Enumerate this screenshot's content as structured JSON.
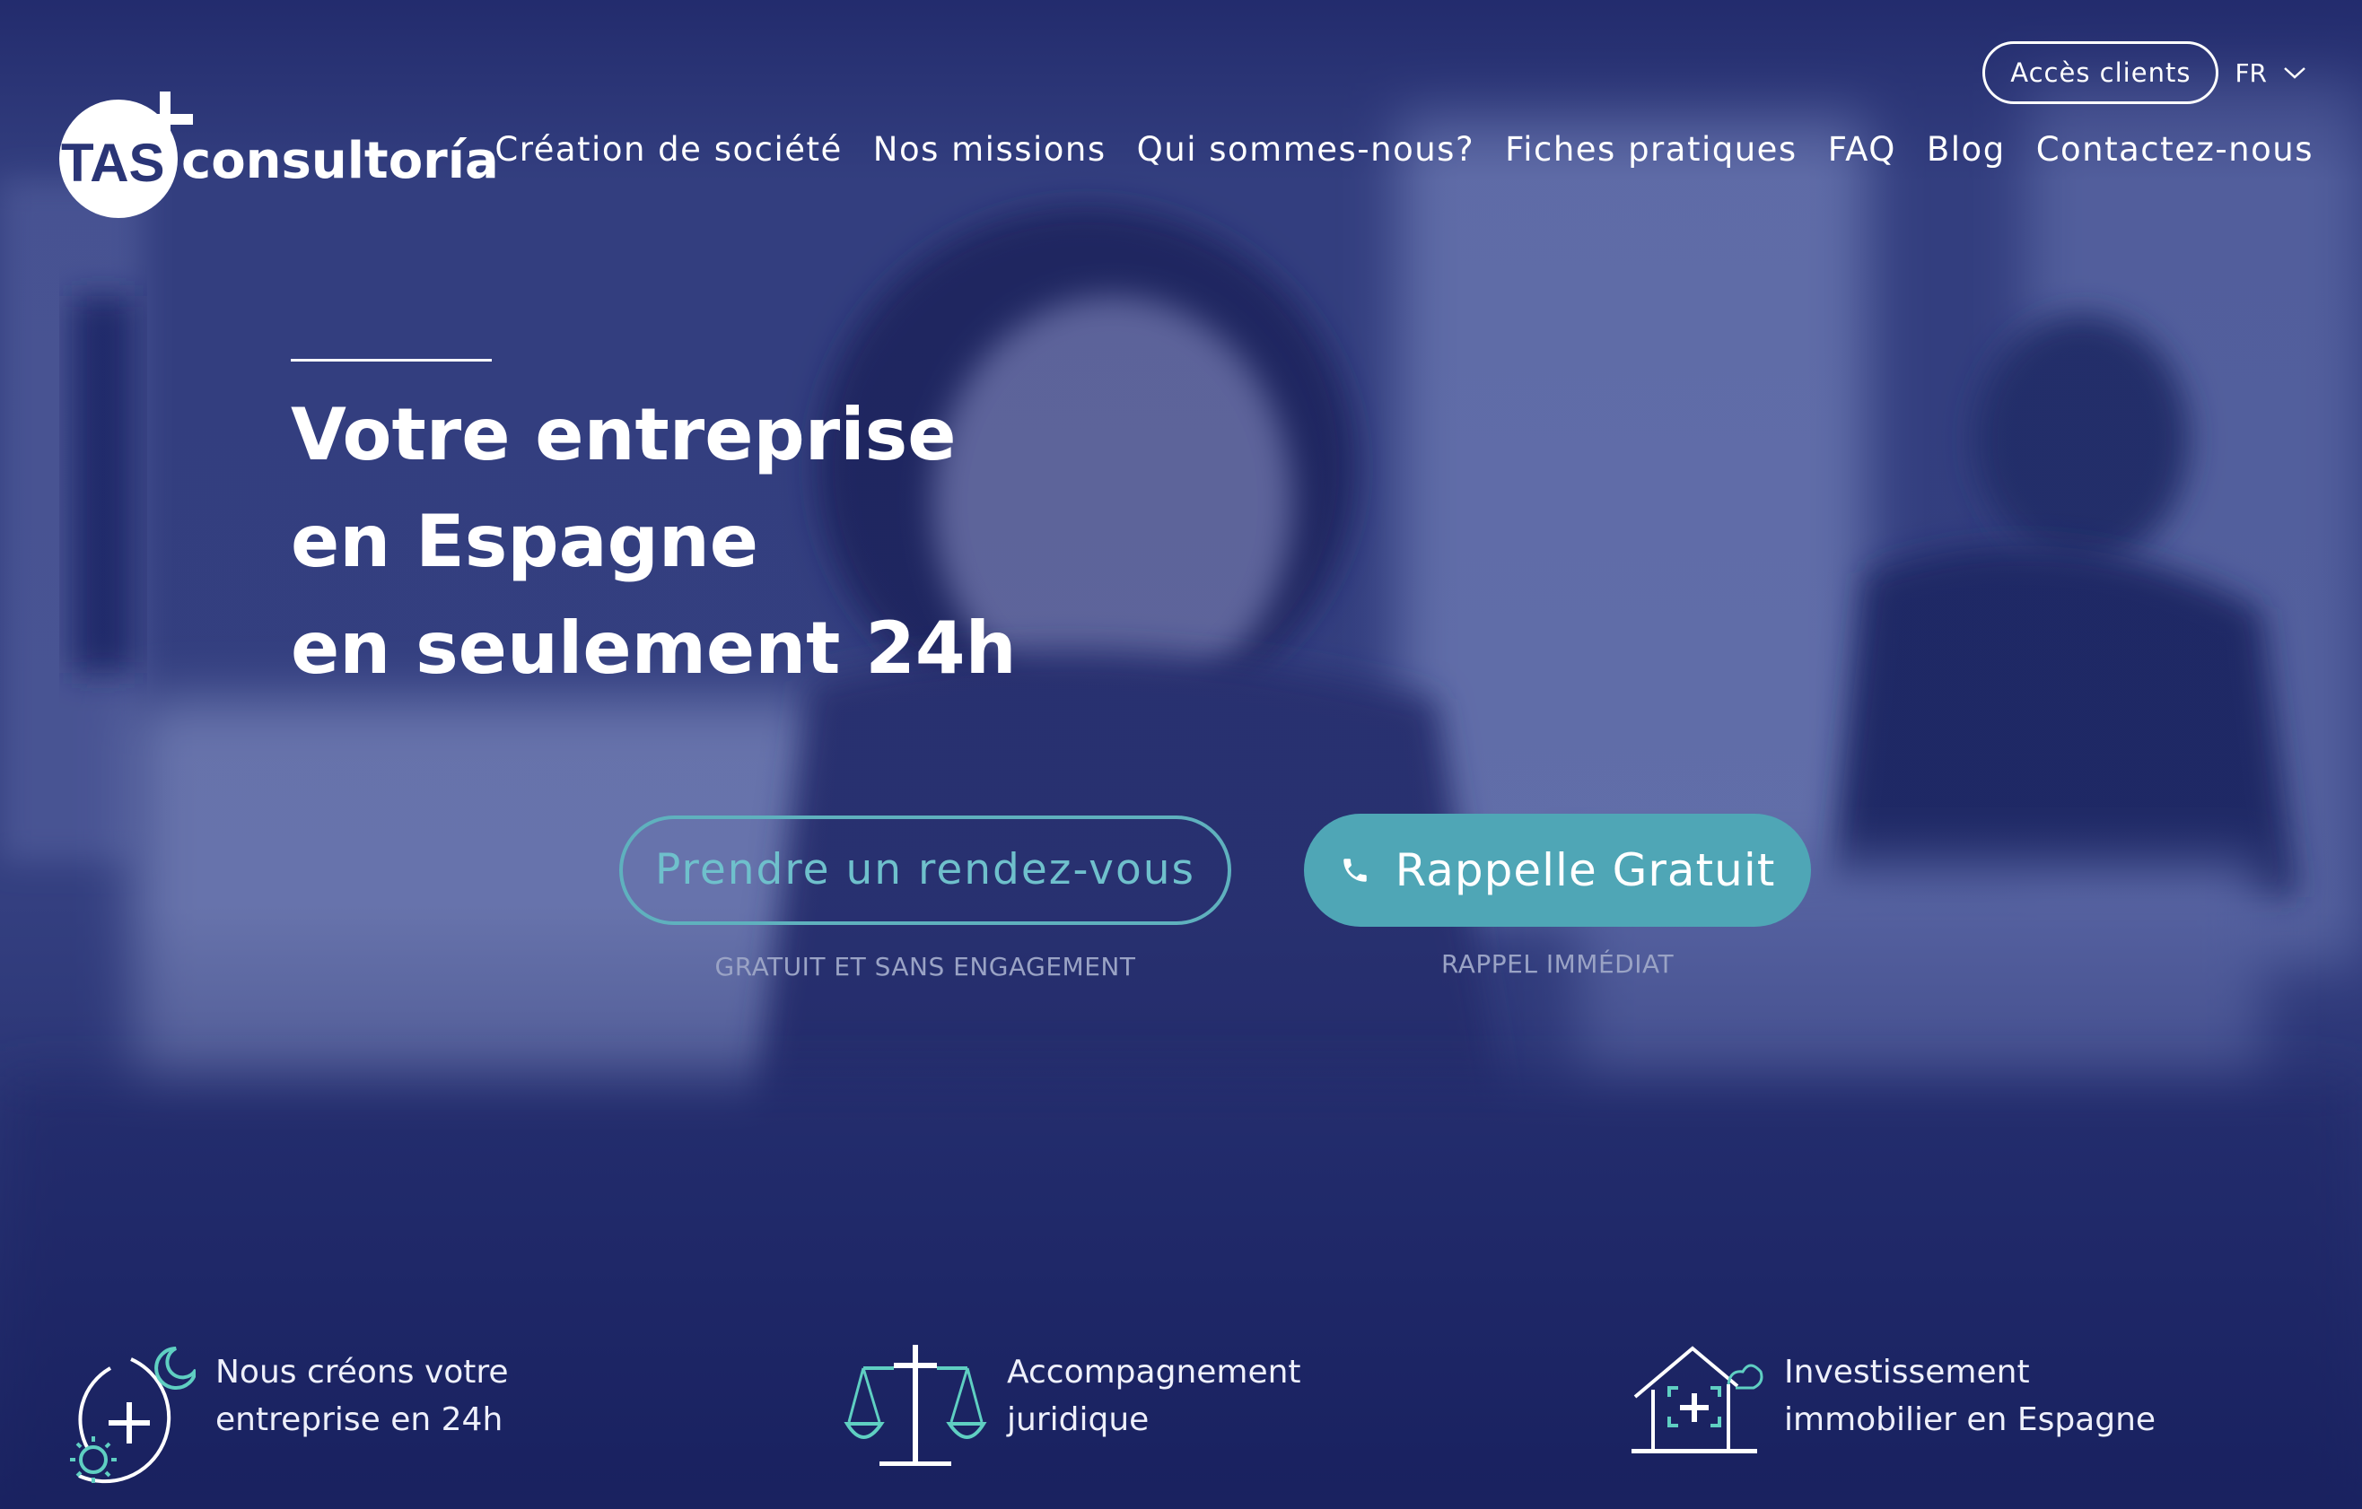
{
  "header": {
    "logo": {
      "brand_left": "TAS",
      "brand_right": "consultoría"
    },
    "client_access": "Accès clients",
    "language": "FR",
    "nav": [
      "Création de société",
      "Nos missions",
      "Qui sommes-nous?",
      "Fiches pratiques",
      "FAQ",
      "Blog",
      "Contactez-nous"
    ]
  },
  "hero": {
    "headline": [
      "Votre entreprise",
      "en Espagne",
      "en seulement 24h"
    ],
    "cta_appointment": {
      "label": "Prendre un rendez-vous",
      "subtitle": "GRATUIT ET SANS ENGAGEMENT"
    },
    "cta_callback": {
      "label": "Rappelle Gratuit",
      "subtitle": "RAPPEL IMMÉDIAT"
    }
  },
  "features": [
    {
      "icon": "day-night-plus-icon",
      "lines": [
        "Nous créons votre",
        "entreprise en 24h"
      ]
    },
    {
      "icon": "scales-justice-icon",
      "lines": [
        "Accompagnement",
        "juridique"
      ]
    },
    {
      "icon": "house-plus-icon",
      "lines": [
        "Investissement",
        "immobilier en Espagne"
      ]
    }
  ],
  "colors": {
    "overlay_navy": "#1f2a6e",
    "accent_teal": "#4fa6b6",
    "outline_teal": "#5fb1be",
    "subtitle_gray": "#9aa3c5"
  }
}
